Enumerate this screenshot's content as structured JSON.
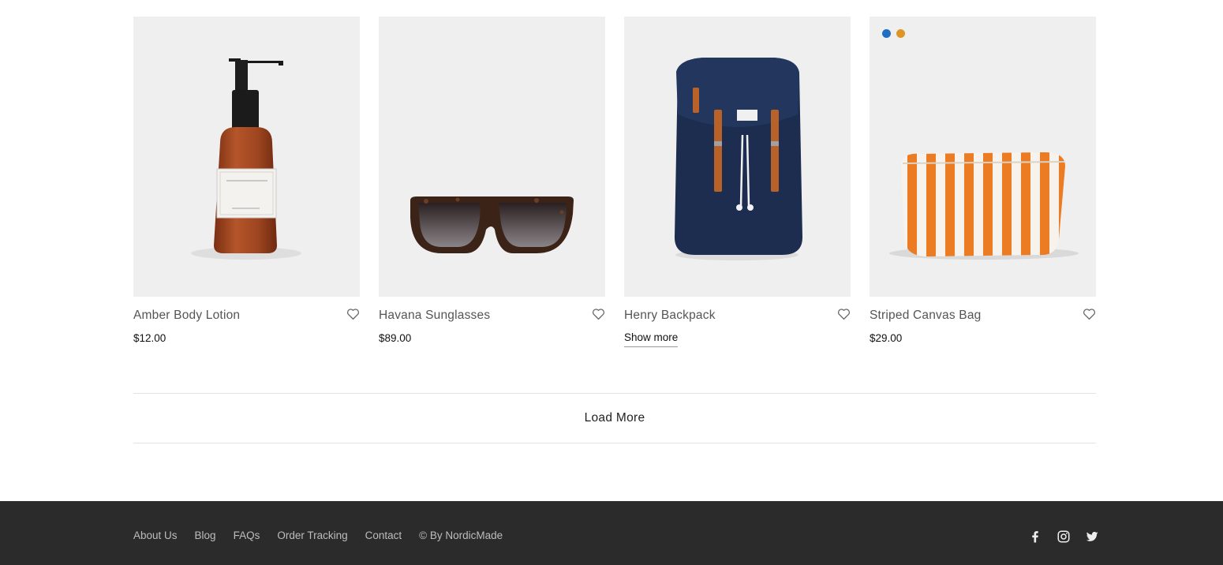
{
  "products": [
    {
      "title": "Amber Body Lotion",
      "price": "$12.00",
      "image": "amber-body-lotion-bottle",
      "heart_icon": "heart-icon"
    },
    {
      "title": "Havana Sunglasses",
      "price": "$89.00",
      "image": "havana-sunglasses",
      "heart_icon": "heart-icon"
    },
    {
      "title": "Henry Backpack",
      "link_label": "Show more",
      "image": "navy-backpack",
      "heart_icon": "heart-icon"
    },
    {
      "title": "Striped Canvas Bag",
      "price": "$29.00",
      "image": "orange-striped-pouch",
      "heart_icon": "heart-icon",
      "swatches": [
        "#1e6fc4",
        "#dd9528"
      ]
    }
  ],
  "load_more": {
    "label": "Load More"
  },
  "footer": {
    "links": [
      "About Us",
      "Blog",
      "FAQs",
      "Order Tracking",
      "Contact"
    ],
    "credit": "© By NordicMade",
    "social_icons": [
      "facebook-icon",
      "instagram-icon",
      "twitter-icon"
    ]
  },
  "colors": {
    "footer_bg": "#2b2b2b",
    "thumb_bg": "#efefef",
    "footer_text": "#bdbdbd"
  }
}
